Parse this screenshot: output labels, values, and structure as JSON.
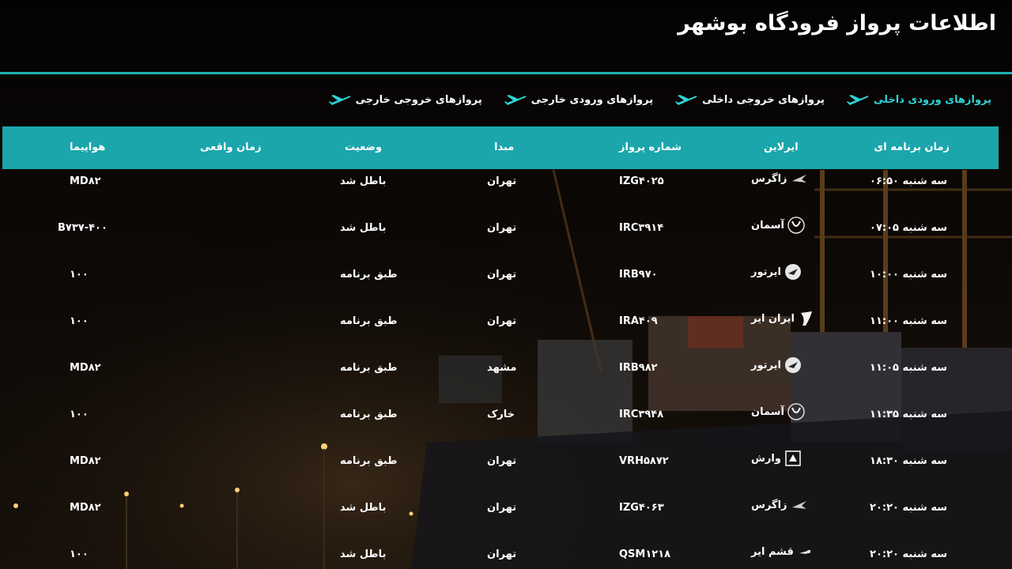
{
  "page": {
    "title": "اطلاعات پرواز فرودگاه بوشهر"
  },
  "colors": {
    "accent": "#1aa6ab",
    "active_tab": "#2fd3d8",
    "background": "#050403"
  },
  "tabs": [
    {
      "label": "پروازهای ورودی داخلی",
      "active": true,
      "icon": "plane-icon"
    },
    {
      "label": "پروازهای خروجی داخلی",
      "active": false,
      "icon": "plane-icon"
    },
    {
      "label": "پروازهای ورودی خارجی",
      "active": false,
      "icon": "plane-icon"
    },
    {
      "label": "پروازهای خروجی خارجی",
      "active": false,
      "icon": "plane-icon"
    }
  ],
  "table": {
    "headers": {
      "scheduled": "زمان برنامه ای",
      "airline": "ایرلاین",
      "flight": "شماره پرواز",
      "origin": "مبدا",
      "status": "وضعیت",
      "actual": "زمان واقعی",
      "aircraft": "هواپیما"
    },
    "rows": [
      {
        "scheduled": "سه شنبه ۰۶:۵۰",
        "airline": "زاگرس",
        "logo": "zagros-logo-icon",
        "flight": "IZG۴۰۲۵",
        "origin": "تهران",
        "status": "باطل شد",
        "actual": "",
        "aircraft": "MD۸۲"
      },
      {
        "scheduled": "سه شنبه ۰۷:۰۵",
        "airline": "آسمان",
        "logo": "aseman-logo-icon",
        "flight": "IRC۳۹۱۴",
        "origin": "تهران",
        "status": "باطل شد",
        "actual": "",
        "aircraft": "B۷۳۷-۴۰۰"
      },
      {
        "scheduled": "سه شنبه ۱۰:۰۰",
        "airline": "ایرتور",
        "logo": "airtour-logo-icon",
        "flight": "IRB۹۷۰",
        "origin": "تهران",
        "status": "طبق برنامه",
        "actual": "",
        "aircraft": "۱۰۰"
      },
      {
        "scheduled": "سه شنبه ۱۱:۰۰",
        "airline": "ایران ایر",
        "logo": "iranair-logo-icon",
        "flight": "IRA۴۰۹",
        "origin": "تهران",
        "status": "طبق برنامه",
        "actual": "",
        "aircraft": "۱۰۰"
      },
      {
        "scheduled": "سه شنبه ۱۱:۰۵",
        "airline": "ایرتور",
        "logo": "airtour-logo-icon",
        "flight": "IRB۹۸۲",
        "origin": "مشهد",
        "status": "طبق برنامه",
        "actual": "",
        "aircraft": "MD۸۲"
      },
      {
        "scheduled": "سه شنبه ۱۱:۳۵",
        "airline": "آسمان",
        "logo": "aseman-logo-icon",
        "flight": "IRC۳۹۴۸",
        "origin": "خارک",
        "status": "طبق برنامه",
        "actual": "",
        "aircraft": "۱۰۰"
      },
      {
        "scheduled": "سه شنبه ۱۸:۳۰",
        "airline": "وارش",
        "logo": "varesh-logo-icon",
        "flight": "VRH۵۸۷۲",
        "origin": "تهران",
        "status": "طبق برنامه",
        "actual": "",
        "aircraft": "MD۸۲"
      },
      {
        "scheduled": "سه شنبه ۲۰:۲۰",
        "airline": "زاگرس",
        "logo": "zagros-logo-icon",
        "flight": "IZG۴۰۶۳",
        "origin": "تهران",
        "status": "باطل شد",
        "actual": "",
        "aircraft": "MD۸۲"
      },
      {
        "scheduled": "سه شنبه ۲۰:۲۰",
        "airline": "قشم ایر",
        "logo": "qeshm-logo-icon",
        "flight": "QSM۱۲۱۸",
        "origin": "تهران",
        "status": "باطل شد",
        "actual": "",
        "aircraft": "۱۰۰"
      }
    ]
  }
}
